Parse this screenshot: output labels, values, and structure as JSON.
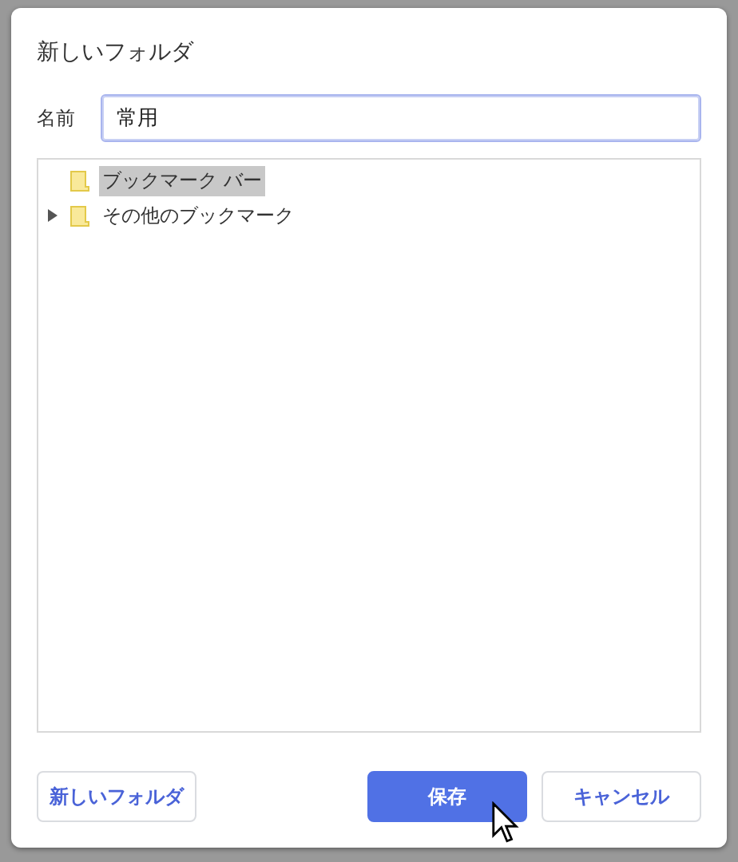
{
  "dialog": {
    "title": "新しいフォルダ"
  },
  "name_field": {
    "label": "名前",
    "value": "常用"
  },
  "tree": {
    "items": [
      {
        "label": "ブックマーク バー",
        "kind": "leaf",
        "selected": true
      },
      {
        "label": "その他のブックマーク",
        "kind": "collapsed",
        "selected": false
      }
    ]
  },
  "buttons": [
    {
      "label": "新しいフォルダ",
      "kind": "secondary"
    },
    {
      "label": "保存",
      "kind": "primary"
    },
    {
      "label": "キャンセル",
      "kind": "secondary"
    }
  ]
}
